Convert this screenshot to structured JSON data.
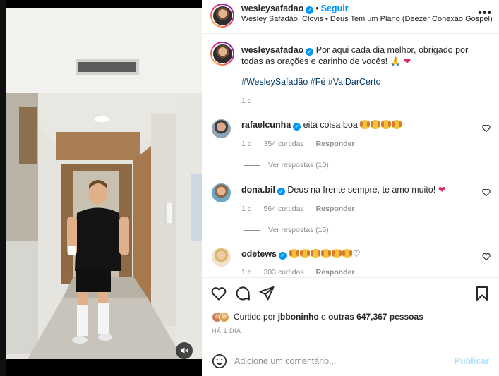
{
  "post": {
    "username": "wesleysafadao",
    "follow_label": "Seguir",
    "audio": "Wesley Safadão, Clovis • Deus Tem um Plano (Deezer Conexão Gospel)",
    "caption": "Por aqui cada dia melhor, obrigado por todas as orações e carinho de vocês! 🙏",
    "caption_heart": "❤",
    "hashtags": "#WesleySafadão #Fé #VaiDarCerto",
    "caption_age": "1 d"
  },
  "comments": [
    {
      "username": "rafaelcunha",
      "text": "eita coisa boa",
      "emoji_count": 4,
      "age": "1 d",
      "likes": "354 curtidas",
      "reply_label": "Responder",
      "view_replies": "Ver respostas (10)"
    },
    {
      "username": "dona.bil",
      "text": "Deus na frente sempre, te amo muito!",
      "heart": "❤",
      "age": "1 d",
      "likes": "564 curtidas",
      "reply_label": "Responder",
      "view_replies": "Ver respostas (15)"
    },
    {
      "username": "odetews",
      "text": "",
      "emoji_count": 6,
      "heart": "♡",
      "age": "1 d",
      "likes": "303 curtidas",
      "reply_label": "Responder"
    }
  ],
  "likes_summary": {
    "prefix": "Curtido por",
    "user": "jbboninho",
    "middle": "e",
    "others": "outras 647,367 pessoas"
  },
  "time_ago": "HÁ 1 DIA",
  "add_comment": {
    "placeholder": "Adicione um comentário...",
    "publish_label": "Publicar"
  },
  "more_label": "•••",
  "colors": {
    "link_blue": "#0095f6",
    "hashtag_blue": "#00376b",
    "muted_text": "#8e8e8e",
    "heart_red": "#e0245e",
    "publish_disabled": "#b2dffc"
  },
  "icons": [
    "mute-icon",
    "like-icon",
    "comment-icon",
    "share-icon",
    "save-icon",
    "emoji-icon",
    "more-icon",
    "verified-icon"
  ]
}
